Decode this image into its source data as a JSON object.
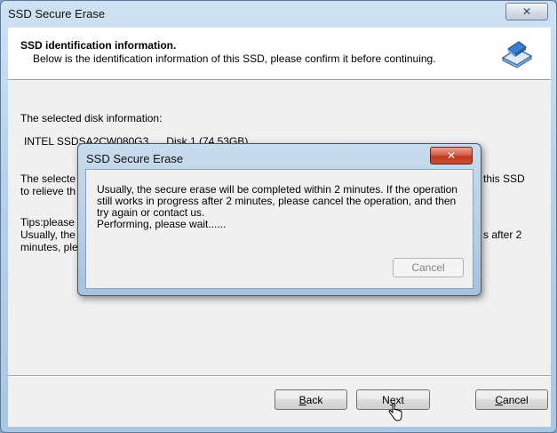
{
  "window": {
    "title": "SSD Secure Erase",
    "close_glyph": "✕"
  },
  "header": {
    "title": "SSD identification information.",
    "subtitle": "Below is the identification information of this SSD, please confirm it before continuing.",
    "icon": "disk-eraser-icon"
  },
  "body": {
    "selected_label": "The selected disk information:",
    "disk_info": "INTEL SSDSA2CW080G3      Disk 1 (74.53GB)",
    "line1_left": "The selecte",
    "line1_right": "this SSD",
    "line2_left": "to relieve th",
    "tips_left": "Tips:please",
    "usually_left": "Usually, the",
    "usually_right": "s after 2",
    "minutes_left": "minutes, ple"
  },
  "buttons": {
    "back": {
      "mnemonic": "B",
      "rest": "ack"
    },
    "next": {
      "first": "N",
      "mnemonic": "e",
      "rest": "xt"
    },
    "cancel": {
      "mnemonic": "C",
      "rest": "ancel"
    }
  },
  "dialog": {
    "title": "SSD Secure Erase",
    "close_glyph": "✕",
    "message_lines": [
      "Usually, the secure erase will be completed within 2 minutes. If the operation",
      "still works in progress after 2 minutes, please cancel the operation, and then",
      "try again or contact us.",
      "Performing, please wait......"
    ],
    "cancel_label": "Cancel"
  },
  "colors": {
    "frame": "#b8d1e8",
    "dialog_close": "#c9502f",
    "client_bg": "#f0f0f0"
  }
}
